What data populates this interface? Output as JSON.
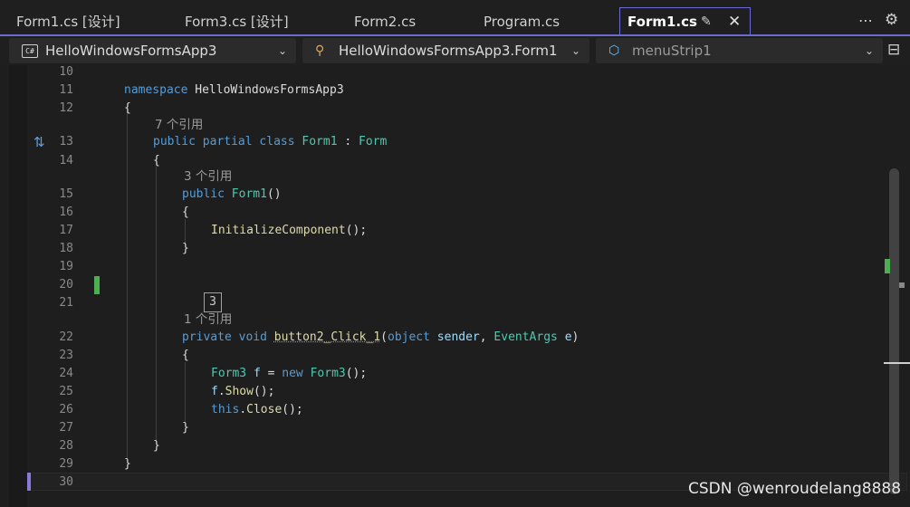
{
  "tabs": [
    {
      "label": "Form1.cs [设计]"
    },
    {
      "label": "Form3.cs [设计]"
    },
    {
      "label": "Form2.cs"
    },
    {
      "label": "Program.cs"
    },
    {
      "label": "Form1.cs",
      "active": true
    }
  ],
  "nav": {
    "project": "HelloWindowsFormsApp3",
    "class": "HelloWindowsFormsApp3.Form1",
    "member": "menuStrip1",
    "cs_badge": "C#"
  },
  "code": {
    "lens": {
      "form1_refs": "7 个引用",
      "ctor_refs": "3 个引用",
      "click_refs": "1 个引用",
      "hint": "3"
    },
    "tokens": {
      "namespace_kw": "namespace",
      "namespace_name": "HelloWindowsFormsApp3",
      "public": "public",
      "partial": "partial",
      "class": "class",
      "form1": "Form1",
      "colon": ":",
      "form": "Form",
      "ctor_name": "Form1",
      "init": "InitializeComponent",
      "private": "private",
      "void": "void",
      "method": "button2_Click_1",
      "object": "object",
      "sender": "sender",
      "eventargs": "EventArgs",
      "e": "e",
      "form3": "Form3",
      "f": "f",
      "new": "new",
      "show": "Show",
      "this": "this",
      "close": "Close"
    },
    "line_numbers": [
      "10",
      "11",
      "12",
      "13",
      "14",
      "15",
      "16",
      "17",
      "18",
      "19",
      "20",
      "21",
      "22",
      "23",
      "24",
      "25",
      "26",
      "27",
      "28",
      "29",
      "30"
    ]
  },
  "watermark": "CSDN @wenroudelang8888",
  "colors": {
    "keyword": "#569cd6",
    "type": "#4ec9b0",
    "method": "#dcdcaa",
    "param": "#9cdcfe",
    "active_tab_border": "#6b6bcf",
    "change_marker": "#4caf50"
  }
}
